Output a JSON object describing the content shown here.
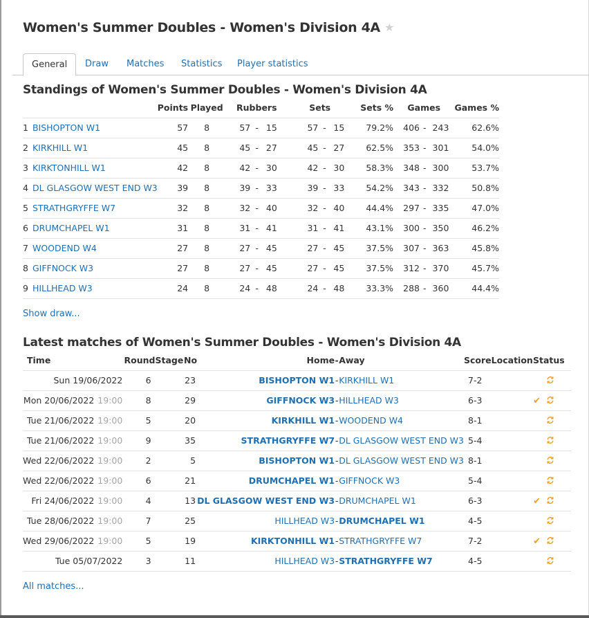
{
  "page": {
    "title": "Women's Summer Doubles - Women's Division 4A"
  },
  "tabs": [
    {
      "label": "General",
      "active": true
    },
    {
      "label": "Draw"
    },
    {
      "label": "Matches"
    },
    {
      "label": "Statistics"
    },
    {
      "label": "Player statistics"
    }
  ],
  "standings": {
    "title": "Standings of Women's Summer Doubles - Women's Division 4A",
    "headers": {
      "points": "Points",
      "played": "Played",
      "rubbers": "Rubbers",
      "sets": "Sets",
      "sets_pct": "Sets %",
      "games": "Games",
      "games_pct": "Games %"
    },
    "rows": [
      {
        "pos": "1",
        "team": "BISHOPTON W1",
        "points": "57",
        "played": "8",
        "rub_w": "57",
        "rub_l": "15",
        "set_w": "57",
        "set_l": "15",
        "sets_pct": "79.2%",
        "g_w": "406",
        "g_l": "243",
        "games_pct": "62.6%"
      },
      {
        "pos": "2",
        "team": "KIRKHILL W1",
        "points": "45",
        "played": "8",
        "rub_w": "45",
        "rub_l": "27",
        "set_w": "45",
        "set_l": "27",
        "sets_pct": "62.5%",
        "g_w": "353",
        "g_l": "301",
        "games_pct": "54.0%"
      },
      {
        "pos": "3",
        "team": "KIRKTONHILL W1",
        "points": "42",
        "played": "8",
        "rub_w": "42",
        "rub_l": "30",
        "set_w": "42",
        "set_l": "30",
        "sets_pct": "58.3%",
        "g_w": "348",
        "g_l": "300",
        "games_pct": "53.7%"
      },
      {
        "pos": "4",
        "team": "DL GLASGOW WEST END W3",
        "points": "39",
        "played": "8",
        "rub_w": "39",
        "rub_l": "33",
        "set_w": "39",
        "set_l": "33",
        "sets_pct": "54.2%",
        "g_w": "343",
        "g_l": "332",
        "games_pct": "50.8%"
      },
      {
        "pos": "5",
        "team": "STRATHGRYFFE W7",
        "points": "32",
        "played": "8",
        "rub_w": "32",
        "rub_l": "40",
        "set_w": "32",
        "set_l": "40",
        "sets_pct": "44.4%",
        "g_w": "297",
        "g_l": "335",
        "games_pct": "47.0%"
      },
      {
        "pos": "6",
        "team": "DRUMCHAPEL W1",
        "points": "31",
        "played": "8",
        "rub_w": "31",
        "rub_l": "41",
        "set_w": "31",
        "set_l": "41",
        "sets_pct": "43.1%",
        "g_w": "300",
        "g_l": "350",
        "games_pct": "46.2%"
      },
      {
        "pos": "7",
        "team": "WOODEND W4",
        "points": "27",
        "played": "8",
        "rub_w": "27",
        "rub_l": "45",
        "set_w": "27",
        "set_l": "45",
        "sets_pct": "37.5%",
        "g_w": "307",
        "g_l": "363",
        "games_pct": "45.8%"
      },
      {
        "pos": "8",
        "team": "GIFFNOCK W3",
        "points": "27",
        "played": "8",
        "rub_w": "27",
        "rub_l": "45",
        "set_w": "27",
        "set_l": "45",
        "sets_pct": "37.5%",
        "g_w": "312",
        "g_l": "370",
        "games_pct": "45.7%"
      },
      {
        "pos": "9",
        "team": "HILLHEAD W3",
        "points": "24",
        "played": "8",
        "rub_w": "24",
        "rub_l": "48",
        "set_w": "24",
        "set_l": "48",
        "sets_pct": "33.3%",
        "g_w": "288",
        "g_l": "360",
        "games_pct": "44.4%"
      }
    ],
    "separator": "-",
    "show_draw_label": "Show draw..."
  },
  "matches": {
    "title": "Latest matches of Women's Summer Doubles - Women's Division 4A",
    "headers": {
      "time": "Time",
      "round": "Round",
      "stage": "Stage",
      "no": "No",
      "home": "Home",
      "dash": "-",
      "away": "Away",
      "score": "Score",
      "location": "Location",
      "status": "Status"
    },
    "rows": [
      {
        "date": "Sun 19/06/2022",
        "time": "",
        "round": "6",
        "no": "23",
        "home": "BISHOPTON W1",
        "away": "KIRKHILL W1",
        "winner": "home",
        "score": "7-2",
        "checked": false
      },
      {
        "date": "Mon 20/06/2022",
        "time": "19:00",
        "round": "8",
        "no": "29",
        "home": "GIFFNOCK W3",
        "away": "HILLHEAD W3",
        "winner": "home",
        "score": "6-3",
        "checked": true
      },
      {
        "date": "Tue 21/06/2022",
        "time": "19:00",
        "round": "5",
        "no": "20",
        "home": "KIRKHILL W1",
        "away": "WOODEND W4",
        "winner": "home",
        "score": "8-1",
        "checked": false
      },
      {
        "date": "Tue 21/06/2022",
        "time": "19:00",
        "round": "9",
        "no": "35",
        "home": "STRATHGRYFFE W7",
        "away": "DL GLASGOW WEST END W3",
        "winner": "home",
        "score": "5-4",
        "checked": false
      },
      {
        "date": "Wed 22/06/2022",
        "time": "19:00",
        "round": "2",
        "no": "5",
        "home": "BISHOPTON W1",
        "away": "DL GLASGOW WEST END W3",
        "winner": "home",
        "score": "8-1",
        "checked": false
      },
      {
        "date": "Wed 22/06/2022",
        "time": "19:00",
        "round": "6",
        "no": "21",
        "home": "DRUMCHAPEL W1",
        "away": "GIFFNOCK W3",
        "winner": "home",
        "score": "5-4",
        "checked": false
      },
      {
        "date": "Fri 24/06/2022",
        "time": "19:00",
        "round": "4",
        "no": "13",
        "home": "DL GLASGOW WEST END W3",
        "away": "DRUMCHAPEL W1",
        "winner": "home",
        "score": "6-3",
        "checked": true
      },
      {
        "date": "Tue 28/06/2022",
        "time": "19:00",
        "round": "7",
        "no": "25",
        "home": "HILLHEAD W3",
        "away": "DRUMCHAPEL W1",
        "winner": "away",
        "score": "4-5",
        "checked": false
      },
      {
        "date": "Wed 29/06/2022",
        "time": "19:00",
        "round": "5",
        "no": "19",
        "home": "KIRKTONHILL W1",
        "away": "STRATHGRYFFE W7",
        "winner": "home",
        "score": "7-2",
        "checked": true
      },
      {
        "date": "Tue 05/07/2022",
        "time": "",
        "round": "3",
        "no": "11",
        "home": "HILLHEAD W3",
        "away": "STRATHGRYFFE W7",
        "winner": "away",
        "score": "4-5",
        "checked": false
      }
    ],
    "all_matches_label": "All matches..."
  },
  "icons": {
    "star": "star-icon",
    "check": "check-icon",
    "status": "refresh-icon"
  },
  "colors": {
    "link": "#1f6fb2",
    "check": "#f0a020",
    "status_icon": "#f0a020"
  }
}
